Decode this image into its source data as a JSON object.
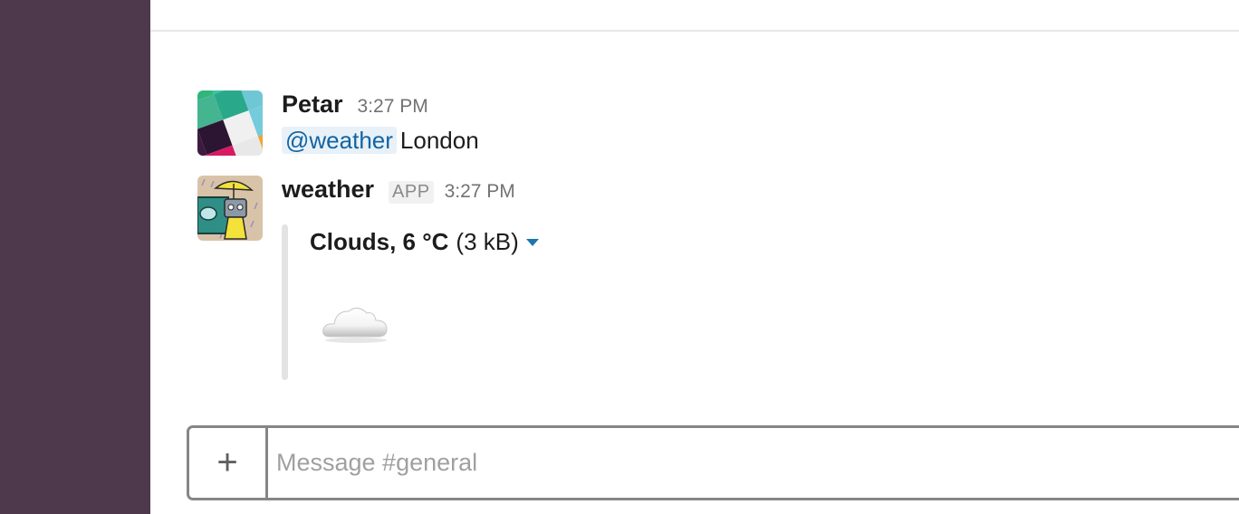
{
  "channel": {
    "name": "general"
  },
  "messages": [
    {
      "sender": "Petar",
      "time": "3:27 PM",
      "mention": "@weather",
      "text": "London",
      "avatar_icon": "multicolor-grid-avatar"
    },
    {
      "sender": "weather",
      "badge": "APP",
      "time": "3:27 PM",
      "avatar_icon": "weather-robot-umbrella-avatar",
      "attachment": {
        "title": "Clouds, 6 °C",
        "size": "(3 kB)",
        "image_icon": "cloud-icon"
      }
    }
  ],
  "composer": {
    "placeholder": "Message #general",
    "value": "",
    "add_label": "+"
  },
  "colors": {
    "sidebar": "#4d394b",
    "mention_text": "#1264a3",
    "mention_bg": "#e8f1f8",
    "caret": "#1d75b3"
  }
}
